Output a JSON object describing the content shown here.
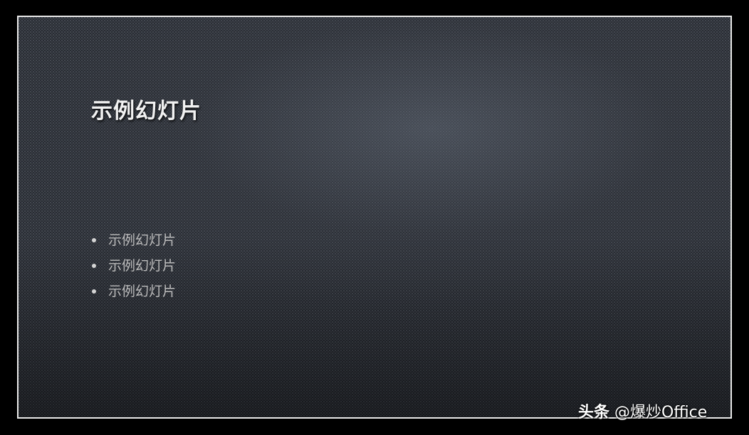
{
  "slide": {
    "title": "示例幻灯片",
    "bullets": [
      {
        "text": "示例幻灯片"
      },
      {
        "text": "示例幻灯片"
      },
      {
        "text": "示例幻灯片"
      }
    ]
  },
  "watermark": {
    "brand": "头条",
    "handle": "@爆炒Office"
  },
  "colors": {
    "page_background": "#000000",
    "slide_border": "#e9e9e9",
    "slide_background": "#262930",
    "title_text": "#f2f2f2",
    "bullet_text": "#bcbcbc"
  }
}
